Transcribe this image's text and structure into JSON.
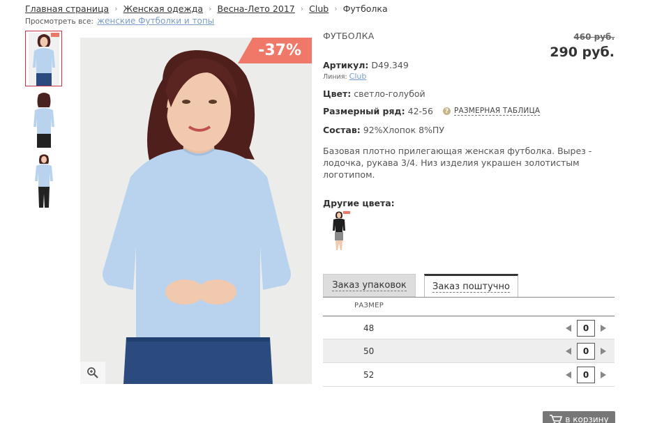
{
  "breadcrumb": {
    "items": [
      "Главная страница",
      "Женская одежда",
      "Весна-Лето 2017",
      "Club"
    ],
    "current": "Футболка",
    "separator": "›"
  },
  "see_all": {
    "label": "Просмотреть все:",
    "link": "женские Футболки и топы"
  },
  "gallery": {
    "discount_badge": "-37%",
    "thumbnails_count": 3
  },
  "product": {
    "title": "ФУТБОЛКА",
    "old_price": "460 руб.",
    "new_price": "290 руб.",
    "article_label": "Артикул:",
    "article_value": "D49.349",
    "line_label": "Линия:",
    "line_value": "Club",
    "color_label": "Цвет:",
    "color_value": "светло-голубой",
    "size_range_label": "Размерный ряд:",
    "size_range_value": "42-56",
    "size_table_link": "РАЗМЕРНАЯ ТАБЛИЦА",
    "composition_label": "Состав:",
    "composition_value": "92%Хлопок 8%ПУ",
    "description": "Базовая плотно прилегающая женская футболка. Вырез - лодочка, рукава 3/4. Низ изделия украшен золотистым логотипом.",
    "other_colors_label": "Другие цвета:"
  },
  "order": {
    "tabs": [
      "Заказ упаковок",
      "Заказ поштучно"
    ],
    "active_tab": 1,
    "column_header": "РАЗМЕР",
    "rows": [
      {
        "size": "48",
        "qty": "0"
      },
      {
        "size": "50",
        "qty": "0"
      },
      {
        "size": "52",
        "qty": "0"
      }
    ],
    "cart_button": "в корзину"
  },
  "colors": {
    "badge": "#f07868",
    "thumb_border": "#c53349",
    "link": "#7a9cc7",
    "shirt": "#b9d3ee"
  }
}
